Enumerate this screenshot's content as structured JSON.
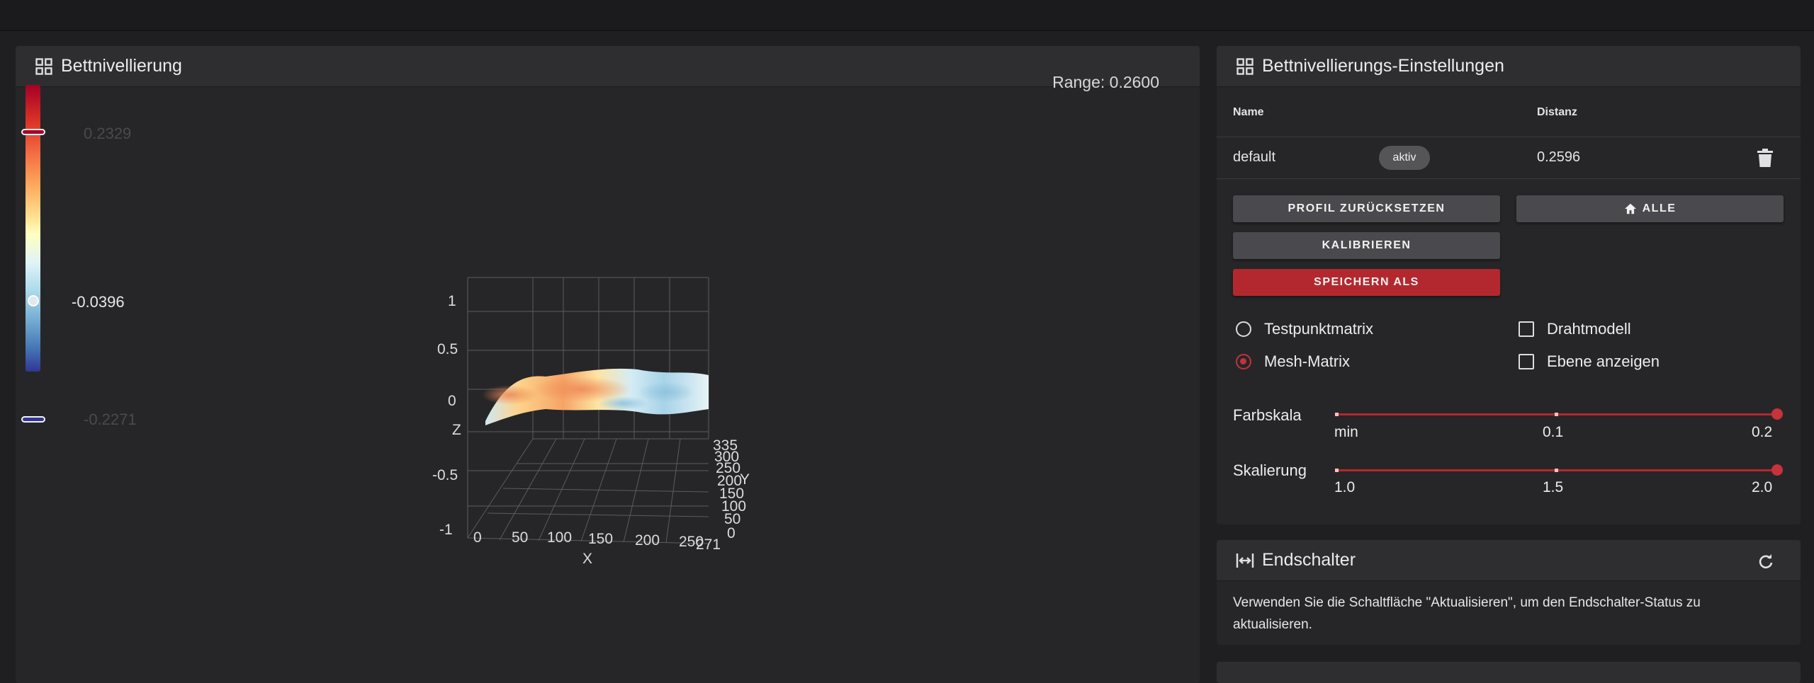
{
  "bed_mesh_card": {
    "title": "Bettnivellierung",
    "range": "Range: 0.2600",
    "colorbar": {
      "max": "0.2329",
      "current": "-0.0396",
      "min": "-0.2271"
    },
    "plot": {
      "z_ticks": [
        "1",
        "0.5",
        "0",
        "-0.5",
        "-1"
      ],
      "z_label": "Z",
      "x_ticks": [
        "0",
        "50",
        "100",
        "150",
        "200",
        "250",
        "271"
      ],
      "x_label": "X",
      "y_ticks": [
        "0",
        "50",
        "100",
        "150",
        "200",
        "250",
        "300",
        "335"
      ],
      "y_label": "Y"
    }
  },
  "settings_card": {
    "title": "Bettnivellierungs-Einstellungen",
    "col_name": "Name",
    "col_distance": "Distanz",
    "profile": {
      "name": "default",
      "status": "aktiv",
      "distance": "0.2596"
    },
    "btn_reset": "PROFIL ZURÜCKSETZEN",
    "btn_home": "ALLE",
    "btn_calibrate": "KALIBRIEREN",
    "btn_save": "SPEICHERN ALS",
    "opt_probe": "Testpunktmatrix",
    "opt_mesh": "Mesh-Matrix",
    "opt_wireframe": "Drahtmodell",
    "opt_plane": "Ebene anzeigen",
    "selected_matrix": "Mesh-Matrix",
    "scale": {
      "label": "Farbskala",
      "ticks": [
        "min",
        "0.1",
        "0.2"
      ],
      "value": "0.2"
    },
    "zoom": {
      "label": "Skalierung",
      "ticks": [
        "1.0",
        "1.5",
        "2.0"
      ],
      "value": "2.0"
    }
  },
  "endstop_card": {
    "title": "Endschalter",
    "text": "Verwenden Sie die Schaltfläche \"Aktualisieren\", um den Endschalter-Status zu aktualisieren."
  },
  "colors": {
    "accent": "#b3282f",
    "card": "#262628",
    "header": "#2e2e31",
    "background": "#1f1f21"
  },
  "icons": [
    "grid-icon",
    "trash-icon",
    "home-icon",
    "arrows-h-icon",
    "refresh-icon"
  ]
}
